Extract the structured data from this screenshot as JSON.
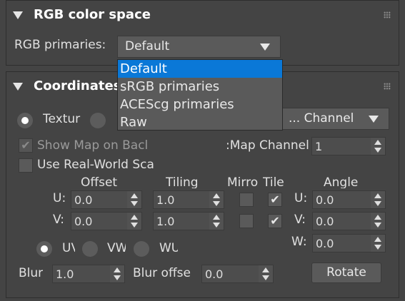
{
  "rgb_section": {
    "title": "RGB color space",
    "primaries_label": "RGB primaries:",
    "primaries_value": "Default",
    "dropdown_options": [
      "Default",
      "sRGB primaries",
      "ACEScg primaries",
      "Raw"
    ]
  },
  "coord_section": {
    "title": "Coordinates",
    "mode_texture_label": "Textur",
    "channel_combo_value": "... Channel",
    "show_map_label": "Show Map on Bacl",
    "map_channel_label": "Map Channel:",
    "map_channel_value": "1",
    "use_real_world_label": "Use Real-World Sca",
    "headers": {
      "offset": "Offset",
      "tiling": "Tiling",
      "mirror": "Mirro",
      "tile": "Tile",
      "angle": "Angle"
    },
    "row_labels": {
      "u": "U:",
      "v": "V:",
      "w": "W:"
    },
    "offset_u": "0.0",
    "offset_v": "0.0",
    "tiling_u": "1.0",
    "tiling_v": "1.0",
    "mirror_u": false,
    "mirror_v": false,
    "tile_u": true,
    "tile_v": true,
    "angle_u": "0.0",
    "angle_v": "0.0",
    "angle_w": "0.0",
    "radio_uv": "UV",
    "radio_vw": "VW",
    "radio_wu": "WU",
    "blur_label": "Blur",
    "blur_value": "1.0",
    "blur_offset_label": "Blur offse",
    "blur_offset_value": "0.0",
    "rotate_label": "Rotate"
  },
  "icons": {
    "collapse": "triangle-down",
    "grip": "dots-grip",
    "check": "✔"
  },
  "colors": {
    "background": "#444444",
    "highlight": "#0a78d7",
    "field": "#4d4d4d"
  }
}
